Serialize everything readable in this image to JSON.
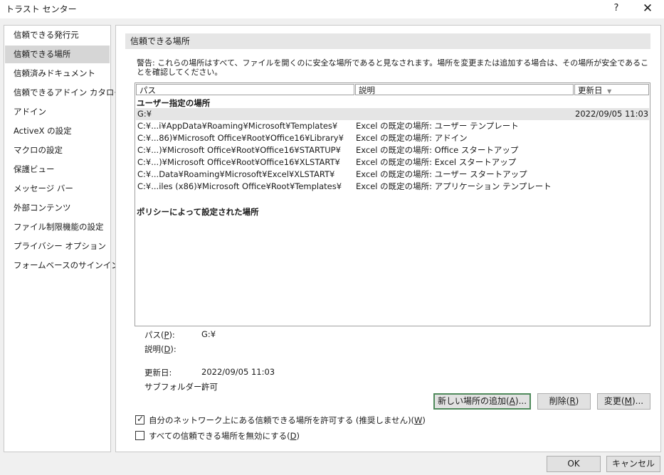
{
  "window": {
    "title": "トラスト センター",
    "help": "?",
    "close": "✕"
  },
  "nav": {
    "items": [
      "信頼できる発行元",
      "信頼できる場所",
      "信頼済みドキュメント",
      "信頼できるアドイン カタログ",
      "アドイン",
      "ActiveX の設定",
      "マクロの設定",
      "保護ビュー",
      "メッセージ バー",
      "外部コンテンツ",
      "ファイル制限機能の設定",
      "プライバシー オプション",
      "フォームベースのサインイン"
    ],
    "selected_index": 1
  },
  "main": {
    "section_title": "信頼できる場所",
    "warning": "警告: これらの場所はすべて、ファイルを開くのに安全な場所であると見なされます。場所を変更または追加する場合は、その場所が安全であることを確認してください。",
    "table": {
      "columns": {
        "path": "パス",
        "description": "説明",
        "date_modified": "更新日",
        "sort_indicator": "▼"
      },
      "user_group_label": "ユーザー指定の場所",
      "user_rows": [
        {
          "path": "G:¥",
          "description": "",
          "date": "2022/09/05 11:03",
          "selected": true
        },
        {
          "path": "C:¥...i¥AppData¥Roaming¥Microsoft¥Templates¥",
          "description": "Excel の既定の場所: ユーザー テンプレート",
          "date": ""
        },
        {
          "path": "C:¥...86)¥Microsoft Office¥Root¥Office16¥Library¥",
          "description": "Excel の既定の場所: アドイン",
          "date": ""
        },
        {
          "path": "C:¥...)¥Microsoft Office¥Root¥Office16¥STARTUP¥",
          "description": "Excel の既定の場所: Office スタートアップ",
          "date": ""
        },
        {
          "path": "C:¥...)¥Microsoft Office¥Root¥Office16¥XLSTART¥",
          "description": "Excel の既定の場所: Excel スタートアップ",
          "date": ""
        },
        {
          "path": "C:¥...Data¥Roaming¥Microsoft¥Excel¥XLSTART¥",
          "description": "Excel の既定の場所: ユーザー スタートアップ",
          "date": ""
        },
        {
          "path": "C:¥...iles (x86)¥Microsoft Office¥Root¥Templates¥",
          "description": "Excel の既定の場所: アプリケーション テンプレート",
          "date": ""
        }
      ],
      "policy_group_label": "ポリシーによって設定された場所"
    },
    "details": {
      "path_label_pre": "パス(",
      "path_label_key": "P",
      "path_label_post": "):",
      "path_value": "G:¥",
      "desc_label_pre": "説明(",
      "desc_label_key": "D",
      "desc_label_post": "):",
      "desc_value": "",
      "date_label": "更新日:",
      "date_value": "2022/09/05 11:03",
      "subfolder_label": "サブフォルダー:",
      "subfolder_value": "許可"
    },
    "buttons": {
      "add_pre": "新しい場所の追加(",
      "add_key": "A",
      "add_post": ")...",
      "remove_pre": "削除(",
      "remove_key": "R",
      "remove_post": ")",
      "modify_pre": "変更(",
      "modify_key": "M",
      "modify_post": ")..."
    },
    "options": {
      "allow_network_pre": "自分のネットワーク上にある信頼できる場所を許可する (推奨しません)(",
      "allow_network_key": "W",
      "allow_network_post": ")",
      "allow_network_checked": true,
      "disable_all_pre": "すべての信頼できる場所を無効にする(",
      "disable_all_key": "D",
      "disable_all_post": ")",
      "disable_all_checked": false
    }
  },
  "footer": {
    "ok": "OK",
    "cancel": "キャンセル"
  }
}
